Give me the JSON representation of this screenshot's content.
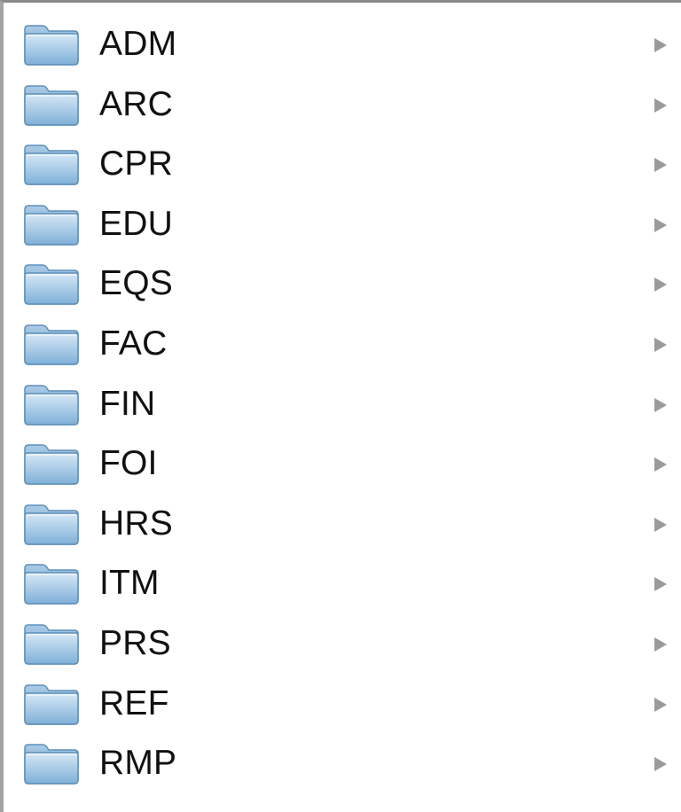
{
  "browser_column": {
    "items": [
      {
        "label": "ADM",
        "icon": "folder-icon",
        "has_children": true
      },
      {
        "label": "ARC",
        "icon": "folder-icon",
        "has_children": true
      },
      {
        "label": "CPR",
        "icon": "folder-icon",
        "has_children": true
      },
      {
        "label": "EDU",
        "icon": "folder-icon",
        "has_children": true
      },
      {
        "label": "EQS",
        "icon": "folder-icon",
        "has_children": true
      },
      {
        "label": "FAC",
        "icon": "folder-icon",
        "has_children": true
      },
      {
        "label": "FIN",
        "icon": "folder-icon",
        "has_children": true
      },
      {
        "label": "FOI",
        "icon": "folder-icon",
        "has_children": true
      },
      {
        "label": "HRS",
        "icon": "folder-icon",
        "has_children": true
      },
      {
        "label": "ITM",
        "icon": "folder-icon",
        "has_children": true
      },
      {
        "label": "PRS",
        "icon": "folder-icon",
        "has_children": true
      },
      {
        "label": "REF",
        "icon": "folder-icon",
        "has_children": true
      },
      {
        "label": "RMP",
        "icon": "folder-icon",
        "has_children": true
      }
    ]
  },
  "colors": {
    "folder_top": "#c9e1f3",
    "folder_bottom": "#7fb0d8",
    "folder_outline": "#5f8fb8",
    "text": "#111111",
    "disclosure_arrow": "#9a9a9a"
  }
}
